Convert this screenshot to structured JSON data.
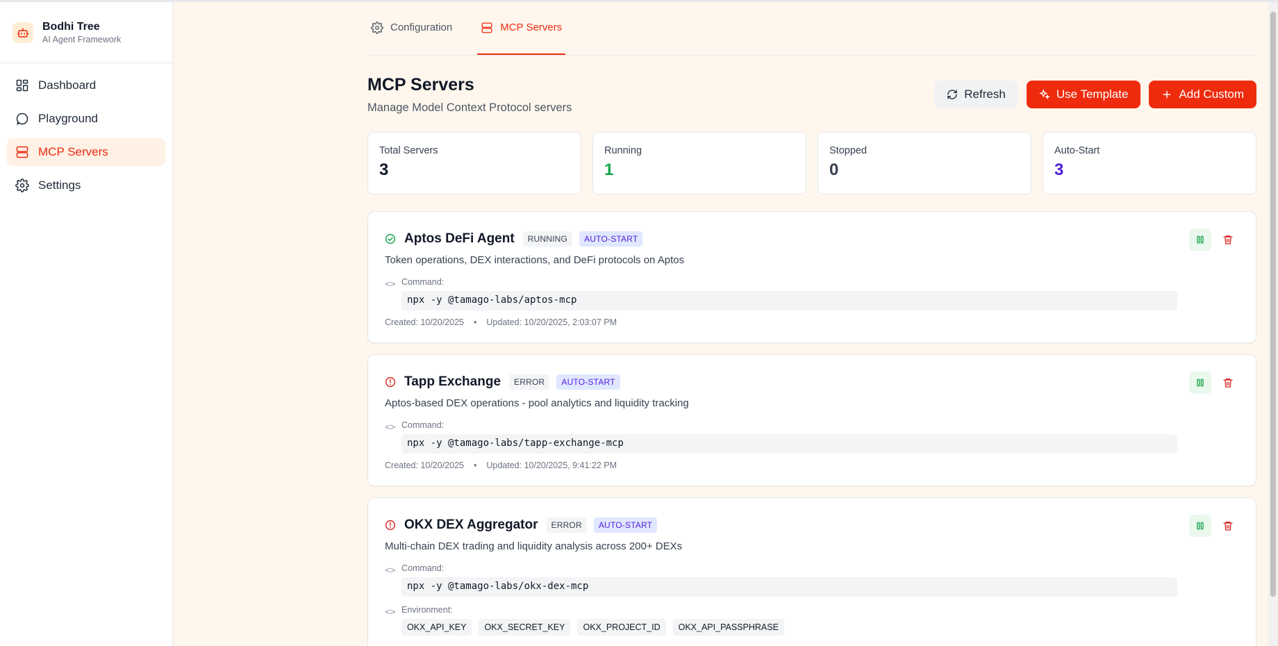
{
  "brand": {
    "title": "Bodhi Tree",
    "subtitle": "AI Agent Framework"
  },
  "sidebar": {
    "items": [
      {
        "label": "Dashboard",
        "icon": "dashboard-icon"
      },
      {
        "label": "Playground",
        "icon": "chat-bubble-icon"
      },
      {
        "label": "MCP Servers",
        "icon": "server-icon",
        "active": true
      },
      {
        "label": "Settings",
        "icon": "gear-icon"
      }
    ]
  },
  "tabs": [
    {
      "label": "Configuration",
      "icon": "gear-icon"
    },
    {
      "label": "MCP Servers",
      "icon": "server-icon",
      "active": true
    }
  ],
  "header": {
    "title": "MCP Servers",
    "subtitle": "Manage Model Context Protocol servers",
    "refresh_label": "Refresh",
    "template_label": "Use Template",
    "add_label": "Add Custom"
  },
  "stats": [
    {
      "label": "Total Servers",
      "value": "3",
      "color": "#111827"
    },
    {
      "label": "Running",
      "value": "1",
      "color": "#16a34a"
    },
    {
      "label": "Stopped",
      "value": "0",
      "color": "#374151"
    },
    {
      "label": "Auto-Start",
      "value": "3",
      "color": "#4f1ddb"
    }
  ],
  "servers": [
    {
      "name": "Aptos DeFi Agent",
      "status": "RUNNING",
      "auto": "AUTO-START",
      "description": "Token operations, DEX interactions, and DeFi protocols on Aptos",
      "command_label": "Command:",
      "command": "npx -y @tamago-labs/aptos-mcp",
      "created": "Created: 10/20/2025",
      "updated": "Updated: 10/20/2025, 2:03:07 PM"
    },
    {
      "name": "Tapp Exchange",
      "status": "ERROR",
      "auto": "AUTO-START",
      "description": "Aptos-based DEX operations - pool analytics and liquidity tracking",
      "command_label": "Command:",
      "command": "npx -y @tamago-labs/tapp-exchange-mcp",
      "created": "Created: 10/20/2025",
      "updated": "Updated: 10/20/2025, 9:41:22 PM"
    },
    {
      "name": "OKX DEX Aggregator",
      "status": "ERROR",
      "auto": "AUTO-START",
      "description": "Multi-chain DEX trading and liquidity analysis across 200+ DEXs",
      "command_label": "Command:",
      "command": "npx -y @tamago-labs/okx-dex-mcp",
      "env_label": "Environment:",
      "env": [
        "OKX_API_KEY",
        "OKX_SECRET_KEY",
        "OKX_PROJECT_ID",
        "OKX_API_PASSPHRASE"
      ]
    }
  ],
  "meta_separator": "•",
  "colors": {
    "accent": "#ef2b0e",
    "running": "#16a34a",
    "error": "#dc2626",
    "auto": "#4f1ddb"
  }
}
